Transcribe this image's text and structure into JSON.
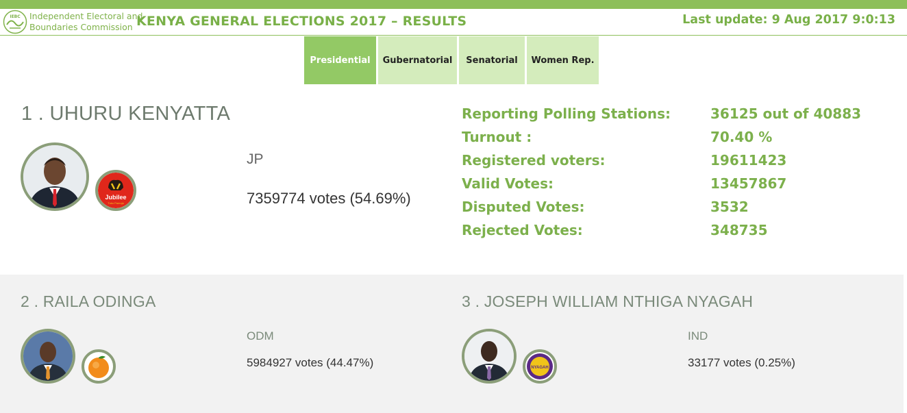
{
  "header": {
    "org_line1": "Independent Electoral and",
    "org_line2": "Boundaries Commission",
    "logo_text": "IEBC",
    "title": "KENYA GENERAL ELECTIONS 2017 – RESULTS",
    "last_update": "Last update: 9 Aug 2017 9:0:13"
  },
  "tabs": [
    {
      "label": "Presidential",
      "active": true
    },
    {
      "label": "Gubernatorial",
      "active": false
    },
    {
      "label": "Senatorial",
      "active": false
    },
    {
      "label": "Women Rep.",
      "active": false
    }
  ],
  "leader": {
    "name": "1 . UHURU KENYATTA",
    "party": "JP",
    "party_logo_text": "Jubilee",
    "party_logo_subtext": "Tuko Pamoja",
    "votes": "7359774 votes (54.69%)"
  },
  "stats": [
    {
      "label": "Reporting Polling Stations:",
      "value": "36125 out of 40883"
    },
    {
      "label": "Turnout :",
      "value": "70.40 %"
    },
    {
      "label": "Registered voters:",
      "value": "19611423"
    },
    {
      "label": "Valid Votes:",
      "value": "13457867"
    },
    {
      "label": "Disputed Votes:",
      "value": "3532"
    },
    {
      "label": "Rejected Votes:",
      "value": "348735"
    }
  ],
  "candidates": [
    {
      "name": "2 . RAILA ODINGA",
      "party": "ODM",
      "votes": "5984927 votes (44.47%)",
      "party_logo_icon": "orange-fruit-icon"
    },
    {
      "name": "3 . JOSEPH WILLIAM NTHIGA NYAGAH",
      "party": "IND",
      "votes": "33177 votes (0.25%)",
      "party_logo_text": "NYAGAH"
    }
  ],
  "colors": {
    "accent": "#8dbf5a",
    "tab_active": "#93c965",
    "tab_inactive": "#d4ecbc",
    "stat_text": "#7cb04c"
  }
}
